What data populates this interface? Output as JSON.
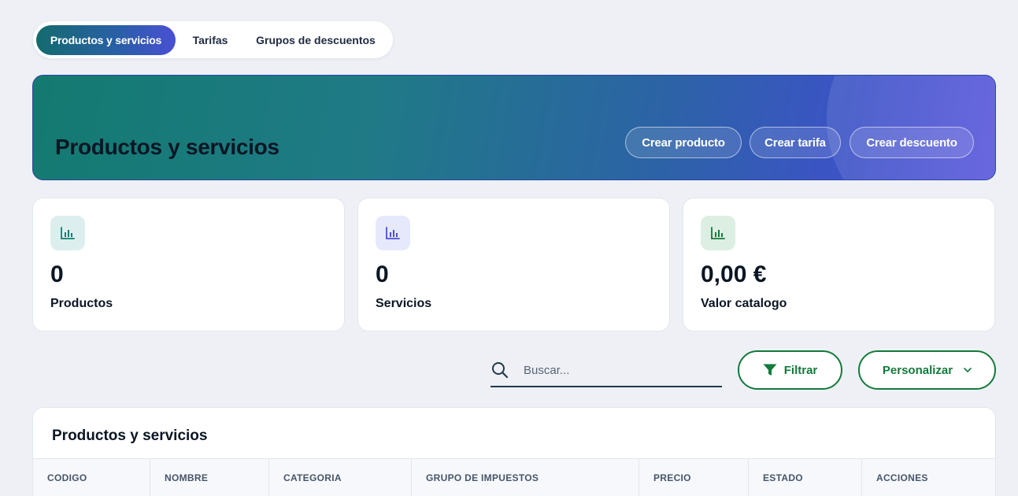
{
  "tabs": [
    {
      "label": "Productos y servicios",
      "active": true
    },
    {
      "label": "Tarifas",
      "active": false
    },
    {
      "label": "Grupos de descuentos",
      "active": false
    }
  ],
  "hero": {
    "title": "Productos y servicios",
    "buttons": [
      "Crear producto",
      "Crear tarifa",
      "Crear descuento"
    ]
  },
  "stats": [
    {
      "value": "0",
      "label": "Productos",
      "icon": "bar-chart-icon",
      "color": "#137a6e"
    },
    {
      "value": "0",
      "label": "Servicios",
      "icon": "bar-chart-icon",
      "color": "#4a4fd4"
    },
    {
      "value": "0,00 €",
      "label": "Valor catalogo",
      "icon": "bar-chart-icon",
      "color": "#137a3a"
    }
  ],
  "search": {
    "placeholder": "Buscar..."
  },
  "actions": {
    "filter_label": "Filtrar",
    "customize_label": "Personalizar"
  },
  "table": {
    "title": "Productos y servicios",
    "columns": [
      "CODIGO",
      "NOMBRE",
      "CATEGORIA",
      "GRUPO DE IMPUESTOS",
      "PRECIO",
      "ESTADO",
      "ACCIONES"
    ]
  },
  "colors": {
    "accent_green": "#137a3a",
    "hero_start": "#137a70",
    "hero_end": "#5a56dc",
    "background": "#eef0f5"
  }
}
